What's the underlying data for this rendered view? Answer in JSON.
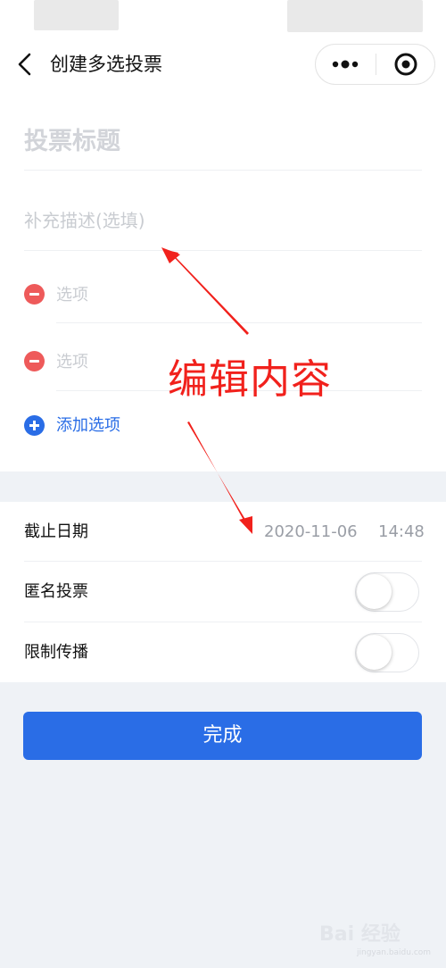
{
  "nav": {
    "title": "创建多选投票",
    "back_icon": "chevron-left-icon",
    "more_icon": "more-dots-icon",
    "close_icon": "target-circle-icon"
  },
  "form": {
    "title_placeholder": "投票标题",
    "description_placeholder": "补充描述(选填)",
    "options": [
      {
        "placeholder": "选项"
      },
      {
        "placeholder": "选项"
      }
    ],
    "add_option_label": "添加选项"
  },
  "settings": {
    "deadline_label": "截止日期",
    "deadline_date": "2020-11-06",
    "deadline_time": "14:48",
    "anonymous_label": "匿名投票",
    "anonymous_on": false,
    "restrict_label": "限制传播",
    "restrict_on": false
  },
  "done_label": "完成",
  "annotation": {
    "text": "编辑内容",
    "color": "#f1211c"
  },
  "colors": {
    "accent": "#2a6de6",
    "danger": "#ee5a5a",
    "background": "#eff2f6"
  },
  "watermark": {
    "text": "Bai 经验",
    "subtext": "jingyan.baidu.com"
  }
}
